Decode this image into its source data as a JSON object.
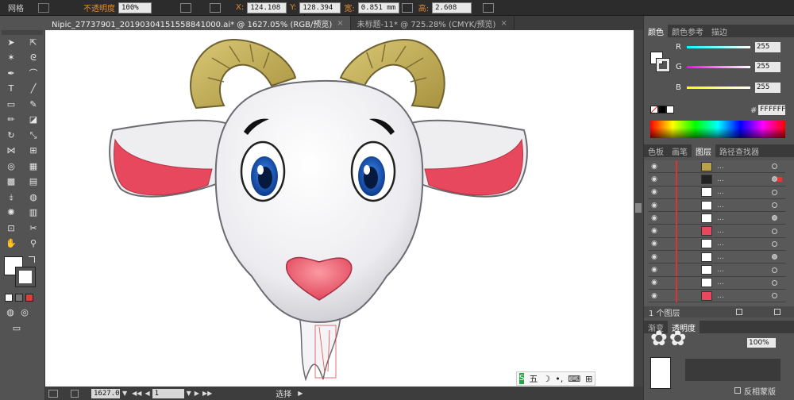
{
  "control_bar": {
    "label_grid": "网格",
    "opacity_label": "不透明度",
    "opacity_value": "100%",
    "x_label": "X:",
    "x_value": "124.108 ：",
    "y_label": "Y:",
    "y_value": "128.394 ：",
    "w_label": "宽:",
    "w_value": "0.851 mm",
    "h_label": "高:",
    "h_value": "2.608 mm"
  },
  "tabs": [
    {
      "label": "Nipic_27737901_20190304151558841000.ai* @ 1627.05% (RGB/预览)",
      "close": "×"
    },
    {
      "label": "未标题-11* @ 725.28% (CMYK/预览)",
      "close": "×"
    }
  ],
  "status": {
    "zoom": "1627.0",
    "page": "1",
    "tool": "选择"
  },
  "panel": {
    "color_tabs": [
      "颜色",
      "颜色参考",
      "描边"
    ],
    "r_label": "R",
    "r_value": "255",
    "g_label": "G",
    "g_value": "255",
    "b_label": "B",
    "b_value": "255",
    "hex_prefix": "#",
    "hex_value": "FFFFFF",
    "layer_tabs": [
      "色板",
      "画笔",
      "图层",
      "路径查找器"
    ],
    "layer_count": "1 个图层",
    "bottom_tabs": [
      "渐变",
      "透明度"
    ],
    "opacity_value": "100%",
    "invert_mask": "反相蒙版"
  },
  "ime": {
    "label": "五"
  },
  "colors": {
    "ui_dark": "#2c2c2c",
    "ui_mid": "#535353",
    "accent_orange": "#e38b2c",
    "goat_white": "#f2f2f4",
    "horn": "#c2ac55",
    "ear_pink": "#e8485e",
    "eye_blue": "#1d5fc5",
    "nose_pink": "#f06a7a"
  }
}
